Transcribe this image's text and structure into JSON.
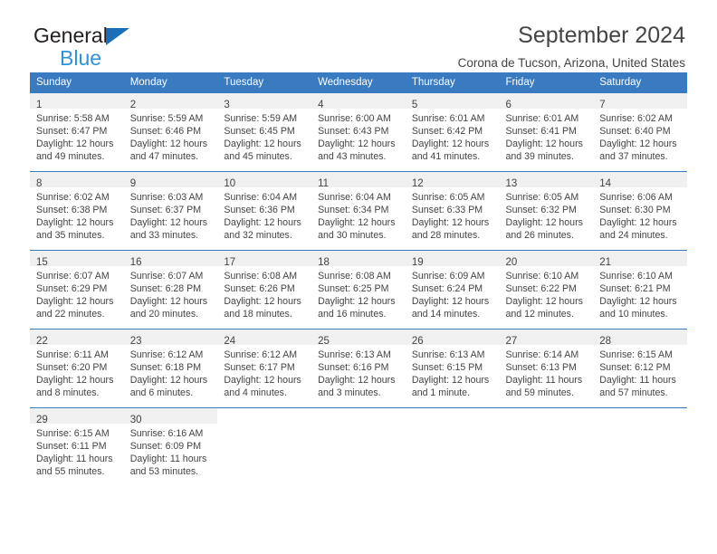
{
  "brand": {
    "line1": "General",
    "line2": "Blue",
    "triangle_color": "#1a6eb5",
    "blue_text_color": "#2e93d9"
  },
  "header": {
    "title": "September 2024",
    "subtitle": "Corona de Tucson, Arizona, United States",
    "accent_color": "#3a7ac1"
  },
  "weekdays": [
    "Sunday",
    "Monday",
    "Tuesday",
    "Wednesday",
    "Thursday",
    "Friday",
    "Saturday"
  ],
  "weeks": [
    [
      {
        "day": "1",
        "sunrise": "Sunrise: 5:58 AM",
        "sunset": "Sunset: 6:47 PM",
        "daylight1": "Daylight: 12 hours",
        "daylight2": "and 49 minutes."
      },
      {
        "day": "2",
        "sunrise": "Sunrise: 5:59 AM",
        "sunset": "Sunset: 6:46 PM",
        "daylight1": "Daylight: 12 hours",
        "daylight2": "and 47 minutes."
      },
      {
        "day": "3",
        "sunrise": "Sunrise: 5:59 AM",
        "sunset": "Sunset: 6:45 PM",
        "daylight1": "Daylight: 12 hours",
        "daylight2": "and 45 minutes."
      },
      {
        "day": "4",
        "sunrise": "Sunrise: 6:00 AM",
        "sunset": "Sunset: 6:43 PM",
        "daylight1": "Daylight: 12 hours",
        "daylight2": "and 43 minutes."
      },
      {
        "day": "5",
        "sunrise": "Sunrise: 6:01 AM",
        "sunset": "Sunset: 6:42 PM",
        "daylight1": "Daylight: 12 hours",
        "daylight2": "and 41 minutes."
      },
      {
        "day": "6",
        "sunrise": "Sunrise: 6:01 AM",
        "sunset": "Sunset: 6:41 PM",
        "daylight1": "Daylight: 12 hours",
        "daylight2": "and 39 minutes."
      },
      {
        "day": "7",
        "sunrise": "Sunrise: 6:02 AM",
        "sunset": "Sunset: 6:40 PM",
        "daylight1": "Daylight: 12 hours",
        "daylight2": "and 37 minutes."
      }
    ],
    [
      {
        "day": "8",
        "sunrise": "Sunrise: 6:02 AM",
        "sunset": "Sunset: 6:38 PM",
        "daylight1": "Daylight: 12 hours",
        "daylight2": "and 35 minutes."
      },
      {
        "day": "9",
        "sunrise": "Sunrise: 6:03 AM",
        "sunset": "Sunset: 6:37 PM",
        "daylight1": "Daylight: 12 hours",
        "daylight2": "and 33 minutes."
      },
      {
        "day": "10",
        "sunrise": "Sunrise: 6:04 AM",
        "sunset": "Sunset: 6:36 PM",
        "daylight1": "Daylight: 12 hours",
        "daylight2": "and 32 minutes."
      },
      {
        "day": "11",
        "sunrise": "Sunrise: 6:04 AM",
        "sunset": "Sunset: 6:34 PM",
        "daylight1": "Daylight: 12 hours",
        "daylight2": "and 30 minutes."
      },
      {
        "day": "12",
        "sunrise": "Sunrise: 6:05 AM",
        "sunset": "Sunset: 6:33 PM",
        "daylight1": "Daylight: 12 hours",
        "daylight2": "and 28 minutes."
      },
      {
        "day": "13",
        "sunrise": "Sunrise: 6:05 AM",
        "sunset": "Sunset: 6:32 PM",
        "daylight1": "Daylight: 12 hours",
        "daylight2": "and 26 minutes."
      },
      {
        "day": "14",
        "sunrise": "Sunrise: 6:06 AM",
        "sunset": "Sunset: 6:30 PM",
        "daylight1": "Daylight: 12 hours",
        "daylight2": "and 24 minutes."
      }
    ],
    [
      {
        "day": "15",
        "sunrise": "Sunrise: 6:07 AM",
        "sunset": "Sunset: 6:29 PM",
        "daylight1": "Daylight: 12 hours",
        "daylight2": "and 22 minutes."
      },
      {
        "day": "16",
        "sunrise": "Sunrise: 6:07 AM",
        "sunset": "Sunset: 6:28 PM",
        "daylight1": "Daylight: 12 hours",
        "daylight2": "and 20 minutes."
      },
      {
        "day": "17",
        "sunrise": "Sunrise: 6:08 AM",
        "sunset": "Sunset: 6:26 PM",
        "daylight1": "Daylight: 12 hours",
        "daylight2": "and 18 minutes."
      },
      {
        "day": "18",
        "sunrise": "Sunrise: 6:08 AM",
        "sunset": "Sunset: 6:25 PM",
        "daylight1": "Daylight: 12 hours",
        "daylight2": "and 16 minutes."
      },
      {
        "day": "19",
        "sunrise": "Sunrise: 6:09 AM",
        "sunset": "Sunset: 6:24 PM",
        "daylight1": "Daylight: 12 hours",
        "daylight2": "and 14 minutes."
      },
      {
        "day": "20",
        "sunrise": "Sunrise: 6:10 AM",
        "sunset": "Sunset: 6:22 PM",
        "daylight1": "Daylight: 12 hours",
        "daylight2": "and 12 minutes."
      },
      {
        "day": "21",
        "sunrise": "Sunrise: 6:10 AM",
        "sunset": "Sunset: 6:21 PM",
        "daylight1": "Daylight: 12 hours",
        "daylight2": "and 10 minutes."
      }
    ],
    [
      {
        "day": "22",
        "sunrise": "Sunrise: 6:11 AM",
        "sunset": "Sunset: 6:20 PM",
        "daylight1": "Daylight: 12 hours",
        "daylight2": "and 8 minutes."
      },
      {
        "day": "23",
        "sunrise": "Sunrise: 6:12 AM",
        "sunset": "Sunset: 6:18 PM",
        "daylight1": "Daylight: 12 hours",
        "daylight2": "and 6 minutes."
      },
      {
        "day": "24",
        "sunrise": "Sunrise: 6:12 AM",
        "sunset": "Sunset: 6:17 PM",
        "daylight1": "Daylight: 12 hours",
        "daylight2": "and 4 minutes."
      },
      {
        "day": "25",
        "sunrise": "Sunrise: 6:13 AM",
        "sunset": "Sunset: 6:16 PM",
        "daylight1": "Daylight: 12 hours",
        "daylight2": "and 3 minutes."
      },
      {
        "day": "26",
        "sunrise": "Sunrise: 6:13 AM",
        "sunset": "Sunset: 6:15 PM",
        "daylight1": "Daylight: 12 hours",
        "daylight2": "and 1 minute."
      },
      {
        "day": "27",
        "sunrise": "Sunrise: 6:14 AM",
        "sunset": "Sunset: 6:13 PM",
        "daylight1": "Daylight: 11 hours",
        "daylight2": "and 59 minutes."
      },
      {
        "day": "28",
        "sunrise": "Sunrise: 6:15 AM",
        "sunset": "Sunset: 6:12 PM",
        "daylight1": "Daylight: 11 hours",
        "daylight2": "and 57 minutes."
      }
    ],
    [
      {
        "day": "29",
        "sunrise": "Sunrise: 6:15 AM",
        "sunset": "Sunset: 6:11 PM",
        "daylight1": "Daylight: 11 hours",
        "daylight2": "and 55 minutes."
      },
      {
        "day": "30",
        "sunrise": "Sunrise: 6:16 AM",
        "sunset": "Sunset: 6:09 PM",
        "daylight1": "Daylight: 11 hours",
        "daylight2": "and 53 minutes."
      },
      null,
      null,
      null,
      null,
      null
    ]
  ]
}
